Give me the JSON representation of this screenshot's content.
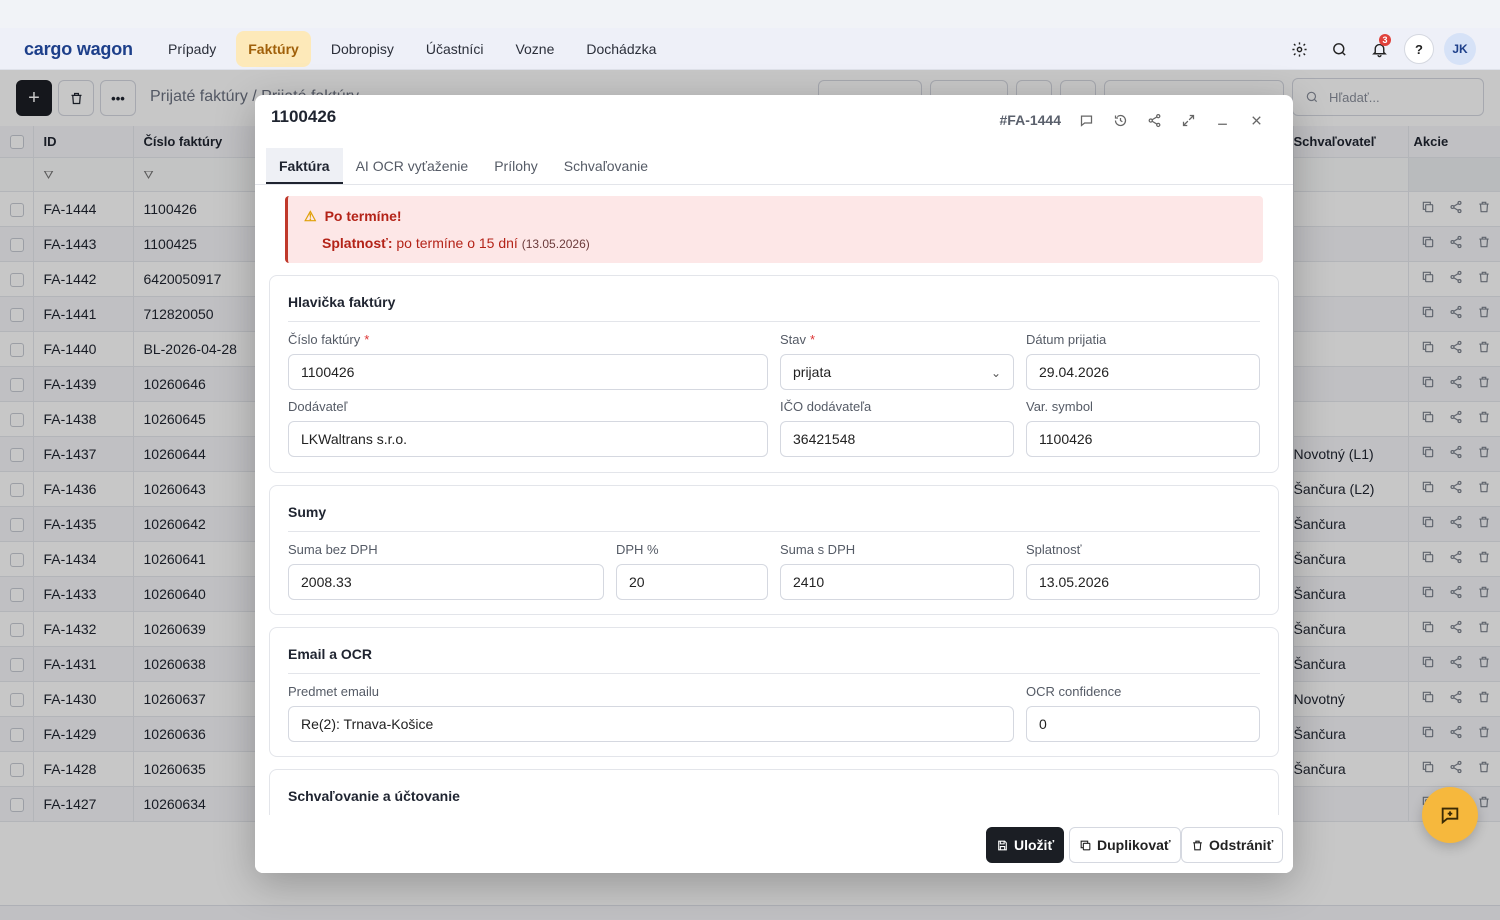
{
  "app": {
    "logo": "cargo wagon"
  },
  "nav": {
    "items": [
      "Prípady",
      "Faktúry",
      "Dobropisy",
      "Účastníci",
      "Vozne",
      "Dochádzka"
    ],
    "active_index": 1,
    "notifications_count": "3",
    "help_label": "?",
    "avatar_initials": "JK"
  },
  "toolbar": {
    "add_label": "+",
    "breadcrumb": "Prijaté faktúry / Prijaté faktúry",
    "search_placeholder": "Hľadať..."
  },
  "table": {
    "columns": [
      "ID",
      "Číslo faktúry",
      "Schvaľovateľ",
      "Akcie"
    ],
    "rows": [
      {
        "id": "FA-1444",
        "number": "1100426",
        "approver": ""
      },
      {
        "id": "FA-1443",
        "number": "1100425",
        "approver": ""
      },
      {
        "id": "FA-1442",
        "number": "6420050917",
        "approver": ""
      },
      {
        "id": "FA-1441",
        "number": "712820050",
        "approver": ""
      },
      {
        "id": "FA-1440",
        "number": "BL-2026-04-28",
        "approver": ""
      },
      {
        "id": "FA-1439",
        "number": "10260646",
        "approver": ""
      },
      {
        "id": "FA-1438",
        "number": "10260645",
        "approver": ""
      },
      {
        "id": "FA-1437",
        "number": "10260644",
        "approver": "Novotný (L1)"
      },
      {
        "id": "FA-1436",
        "number": "10260643",
        "approver": "Šančura (L2)"
      },
      {
        "id": "FA-1435",
        "number": "10260642",
        "approver": "Šančura"
      },
      {
        "id": "FA-1434",
        "number": "10260641",
        "approver": "Šančura"
      },
      {
        "id": "FA-1433",
        "number": "10260640",
        "approver": "Šančura"
      },
      {
        "id": "FA-1432",
        "number": "10260639",
        "approver": "Šančura"
      },
      {
        "id": "FA-1431",
        "number": "10260638",
        "approver": "Šančura"
      },
      {
        "id": "FA-1430",
        "number": "10260637",
        "approver": "Novotný"
      },
      {
        "id": "FA-1429",
        "number": "10260636",
        "approver": "Šančura"
      },
      {
        "id": "FA-1428",
        "number": "10260635",
        "approver": "Šančura"
      },
      {
        "id": "FA-1427",
        "number": "10260634",
        "approver": ""
      }
    ]
  },
  "modal": {
    "title": "1100426",
    "code": "#FA-1444",
    "tabs": [
      "Faktúra",
      "AI OCR vyťaženie",
      "Prílohy",
      "Schvaľovanie"
    ],
    "active_tab": 0,
    "alert": {
      "title": "Po termíne!",
      "label": "Splatnosť:",
      "text": "po termíne o 15 dní",
      "date": "(13.05.2026)"
    },
    "header_section": {
      "title": "Hlavička faktúry",
      "invoice_number_label": "Číslo faktúry",
      "invoice_number": "1100426",
      "status_label": "Stav",
      "status": "prijata",
      "received_label": "Dátum prijatia",
      "received": "29.04.2026",
      "supplier_label": "Dodávateľ",
      "supplier": "LKWaltrans s.r.o.",
      "ico_label": "IČO dodávateľa",
      "ico": "36421548",
      "vs_label": "Var. symbol",
      "vs": "1100426"
    },
    "sums_section": {
      "title": "Sumy",
      "net_label": "Suma bez DPH",
      "net": "2008.33",
      "vat_label": "DPH %",
      "vat": "20",
      "gross_label": "Suma s DPH",
      "gross": "2410",
      "due_label": "Splatnosť",
      "due": "13.05.2026"
    },
    "email_section": {
      "title": "Email a OCR",
      "subject_label": "Predmet emailu",
      "subject": "Re(2): Trnava-Košice",
      "ocr_label": "OCR confidence",
      "ocr": "0"
    },
    "approval_section": {
      "title": "Schvaľovanie a účtovanie"
    },
    "footer": {
      "save": "Uložiť",
      "duplicate": "Duplikovať",
      "delete": "Odstrániť"
    }
  }
}
